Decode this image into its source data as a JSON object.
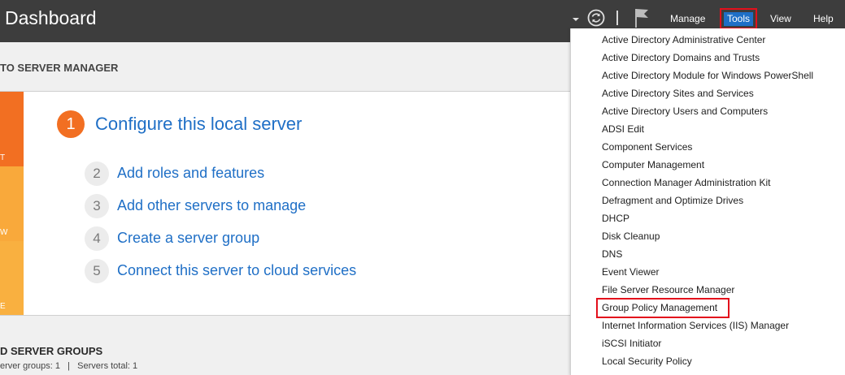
{
  "header": {
    "title": "Dashboard",
    "menu": {
      "manage": "Manage",
      "tools": "Tools",
      "view": "View",
      "help": "Help"
    },
    "icons": [
      "chevron-down-icon",
      "refresh-icon",
      "flag-icon"
    ]
  },
  "welcome": {
    "heading": "TO SERVER MANAGER",
    "tiles": [
      {
        "letter": "T",
        "color": "#f26f22"
      },
      {
        "letter": "W",
        "color": "#f9a93b"
      },
      {
        "letter": "E",
        "color": "#f9b040"
      }
    ],
    "primary_step": {
      "number": "1",
      "label": "Configure this local server"
    },
    "steps": [
      {
        "number": "2",
        "label": "Add roles and features"
      },
      {
        "number": "3",
        "label": "Add other servers to manage"
      },
      {
        "number": "4",
        "label": "Create a server group"
      },
      {
        "number": "5",
        "label": "Connect this server to cloud services"
      }
    ]
  },
  "groups": {
    "heading": "D SERVER GROUPS",
    "stats": "erver groups: 1   |   Servers total: 1"
  },
  "tools_dropdown": {
    "items": [
      "Active Directory Administrative Center",
      "Active Directory Domains and Trusts",
      "Active Directory Module for Windows PowerShell",
      "Active Directory Sites and Services",
      "Active Directory Users and Computers",
      "ADSI Edit",
      "Component Services",
      "Computer Management",
      "Connection Manager Administration Kit",
      "Defragment and Optimize Drives",
      "DHCP",
      "Disk Cleanup",
      "DNS",
      "Event Viewer",
      "File Server Resource Manager",
      "Group Policy Management",
      "Internet Information Services (IIS) Manager",
      "iSCSI Initiator",
      "Local Security Policy"
    ],
    "highlighted_item": "Group Policy Management"
  },
  "colors": {
    "header_bg": "#3d3d3d",
    "accent_blue": "#1f6fc6",
    "accent_orange": "#f26f22",
    "highlight_red": "#e3101c"
  }
}
